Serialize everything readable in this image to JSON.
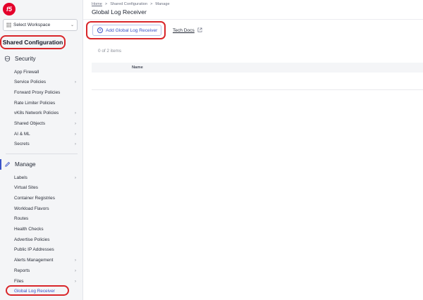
{
  "sidebar": {
    "logo": "f5",
    "workspace": "Select Workspace",
    "section_title": "Shared Configuration",
    "security": {
      "label": "Security",
      "items": [
        {
          "label": "App Firewall",
          "chevron": false
        },
        {
          "label": "Service Policies",
          "chevron": true
        },
        {
          "label": "Forward Proxy Policies",
          "chevron": false
        },
        {
          "label": "Rate Limiter Policies",
          "chevron": false
        },
        {
          "label": "vK8s Network Policies",
          "chevron": true
        },
        {
          "label": "Shared Objects",
          "chevron": true
        },
        {
          "label": "AI & ML",
          "chevron": true
        },
        {
          "label": "Secrets",
          "chevron": true
        }
      ]
    },
    "manage": {
      "label": "Manage",
      "items": [
        {
          "label": "Labels",
          "chevron": true
        },
        {
          "label": "Virtual Sites",
          "chevron": false
        },
        {
          "label": "Container Registries",
          "chevron": false
        },
        {
          "label": "Workload Flavors",
          "chevron": false
        },
        {
          "label": "Routes",
          "chevron": false
        },
        {
          "label": "Health Checks",
          "chevron": false
        },
        {
          "label": "Advertise Policies",
          "chevron": false
        },
        {
          "label": "Public IP Addresses",
          "chevron": false
        },
        {
          "label": "Alerts Management",
          "chevron": true
        },
        {
          "label": "Reports",
          "chevron": true
        },
        {
          "label": "Files",
          "chevron": true
        },
        {
          "label": "Global Log Receiver",
          "chevron": false,
          "active": true
        }
      ]
    }
  },
  "breadcrumb": {
    "home": "Home",
    "sep": ">",
    "shared": "Shared Configuration",
    "manage": "Manage"
  },
  "page": {
    "title": "Global Log Receiver",
    "add_button": "Add Global Log Receiver",
    "tech_docs": "Tech Docs",
    "count": "0 of 2 items",
    "column_name": "Name"
  },
  "colors": {
    "accent": "#3953c8",
    "highlight": "#d9262a",
    "brand": "#e4002b"
  }
}
